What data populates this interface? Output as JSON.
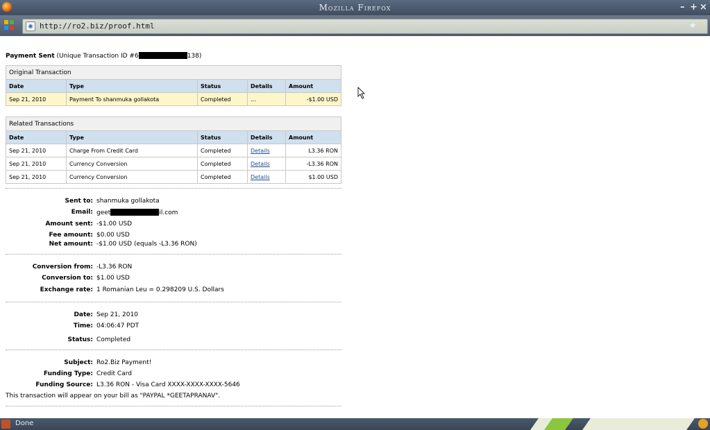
{
  "window": {
    "title": "Mozilla Firefox",
    "minimize": "–",
    "maximize": "+",
    "close": "×"
  },
  "navbar": {
    "url": "http://ro2.biz/proof.html",
    "star": "★",
    "go": "↻"
  },
  "page": {
    "heading_bold": "Payment Sent",
    "heading_prefix": "(Unique Transaction ID #6",
    "heading_suffix": "138)",
    "original": {
      "caption": "Original Transaction",
      "headers": {
        "date": "Date",
        "type": "Type",
        "status": "Status",
        "details": "Details",
        "amount": "Amount"
      },
      "row": {
        "date": "Sep 21, 2010",
        "type": "Payment To shanmuka gollakota",
        "status": "Completed",
        "details": "...",
        "amount": "-$1.00 USD"
      }
    },
    "related": {
      "caption": "Related Transactions",
      "headers": {
        "date": "Date",
        "type": "Type",
        "status": "Status",
        "details": "Details",
        "amount": "Amount"
      },
      "rows": [
        {
          "date": "Sep 21, 2010",
          "type": "Charge From Credit Card",
          "status": "Completed",
          "details": "Details",
          "amount": "L3.36 RON"
        },
        {
          "date": "Sep 21, 2010",
          "type": "Currency Conversion",
          "status": "Completed",
          "details": "Details",
          "amount": "-L3.36 RON"
        },
        {
          "date": "Sep 21, 2010",
          "type": "Currency Conversion",
          "status": "Completed",
          "details": "Details",
          "amount": "$1.00 USD"
        }
      ]
    },
    "sent_to": {
      "label": "Sent to:",
      "value": "shanmuka gollakota"
    },
    "email": {
      "label": "Email:",
      "prefix": "geet",
      "suffix": "il.com"
    },
    "amount_sent": {
      "label": "Amount sent:",
      "value": "-$1.00 USD"
    },
    "fee_amount": {
      "label": "Fee amount:",
      "value": "$0.00 USD"
    },
    "net_amount": {
      "label": "Net amount:",
      "value": "-$1.00 USD (equals -L3.36 RON)"
    },
    "conv_from": {
      "label": "Conversion from:",
      "value": "-L3.36 RON"
    },
    "conv_to": {
      "label": "Conversion to:",
      "value": "$1.00 USD"
    },
    "exchange_rate": {
      "label": "Exchange rate:",
      "value": "1 Romanian Leu = 0.298209 U.S. Dollars"
    },
    "date": {
      "label": "Date:",
      "value": "Sep 21, 2010"
    },
    "time": {
      "label": "Time:",
      "value": "04:06:47 PDT"
    },
    "status": {
      "label": "Status:",
      "value": "Completed"
    },
    "subject": {
      "label": "Subject:",
      "value": "Ro2.Biz Payment!"
    },
    "funding_type": {
      "label": "Funding Type:",
      "value": "Credit Card"
    },
    "funding_source": {
      "label": "Funding Source:",
      "value": "L3.36 RON - Visa Card XXXX-XXXX-XXXX-5646"
    },
    "bill_note": "This transaction will appear on your bill as \"PAYPAL *GEETAPRANAV\"."
  },
  "statusbar": {
    "text": "Done"
  }
}
